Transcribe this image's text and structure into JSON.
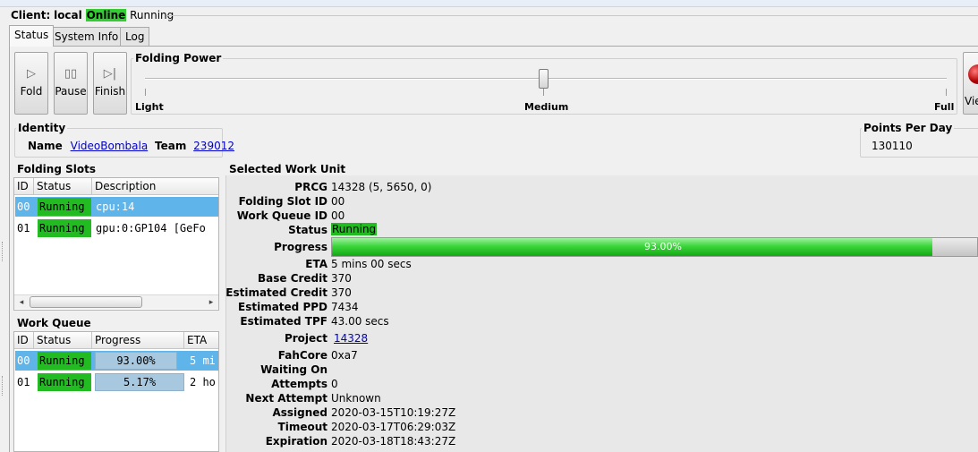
{
  "client": {
    "label": "Client:",
    "name": "local",
    "connection": "Online",
    "state": "Running"
  },
  "tabs": [
    {
      "label": "Status",
      "active": true
    },
    {
      "label": "System Info",
      "active": false
    },
    {
      "label": "Log",
      "active": false
    }
  ],
  "toolbar": {
    "fold": "Fold",
    "pause": "Pause",
    "finish": "Finish",
    "viewer": "Vie"
  },
  "folding_power": {
    "title": "Folding Power",
    "light": "Light",
    "medium": "Medium",
    "full": "Full",
    "level": 0.5
  },
  "identity": {
    "title": "Identity",
    "name_label": "Name",
    "name": "VideoBombala",
    "team_label": "Team",
    "team": "239012"
  },
  "ppd": {
    "title": "Points Per Day",
    "value": "130110"
  },
  "folding_slots": {
    "title": "Folding Slots",
    "headers": [
      "ID",
      "Status",
      "Description"
    ],
    "rows": [
      {
        "id": "00",
        "status": "Running",
        "description": "cpu:14"
      },
      {
        "id": "01",
        "status": "Running",
        "description": "gpu:0:GP104 [GeFo"
      }
    ]
  },
  "work_queue": {
    "title": "Work Queue",
    "headers": [
      "ID",
      "Status",
      "Progress",
      "ETA"
    ],
    "rows": [
      {
        "id": "00",
        "status": "Running",
        "progress": "93.00%",
        "eta": "5 mi"
      },
      {
        "id": "01",
        "status": "Running",
        "progress": "5.17%",
        "eta": "2 ho"
      }
    ]
  },
  "work_unit": {
    "title": "Selected Work Unit",
    "labels": {
      "prcg": "PRCG",
      "slot": "Folding Slot ID",
      "queue": "Work Queue ID",
      "status": "Status",
      "progress": "Progress",
      "eta": "ETA",
      "base_credit": "Base Credit",
      "est_credit": "Estimated Credit",
      "est_ppd": "Estimated PPD",
      "est_tpf": "Estimated TPF",
      "project": "Project",
      "fahcore": "FahCore",
      "waiting": "Waiting On",
      "attempts": "Attempts",
      "next_attempt": "Next Attempt",
      "assigned": "Assigned",
      "timeout": "Timeout",
      "expiration": "Expiration"
    },
    "prcg": "14328 (5, 5650, 0)",
    "slot": "00",
    "queue": "00",
    "status": "Running",
    "progress": "93.00%",
    "progress_value": 0.93,
    "eta": "5 mins 00 secs",
    "base_credit": "370",
    "est_credit": "370",
    "est_ppd": "7434",
    "est_tpf": "43.00 secs",
    "project": "14328",
    "fahcore": "0xa7",
    "waiting": "",
    "attempts": "0",
    "next_attempt": "Unknown",
    "assigned": "2020-03-15T10:19:27Z",
    "timeout": "2020-03-17T06:29:03Z",
    "expiration": "2020-03-18T18:43:27Z"
  },
  "colors": {
    "running": "#22bb22",
    "selected_row": "#5fb4ea",
    "progress_fill": "#3bd63b"
  }
}
